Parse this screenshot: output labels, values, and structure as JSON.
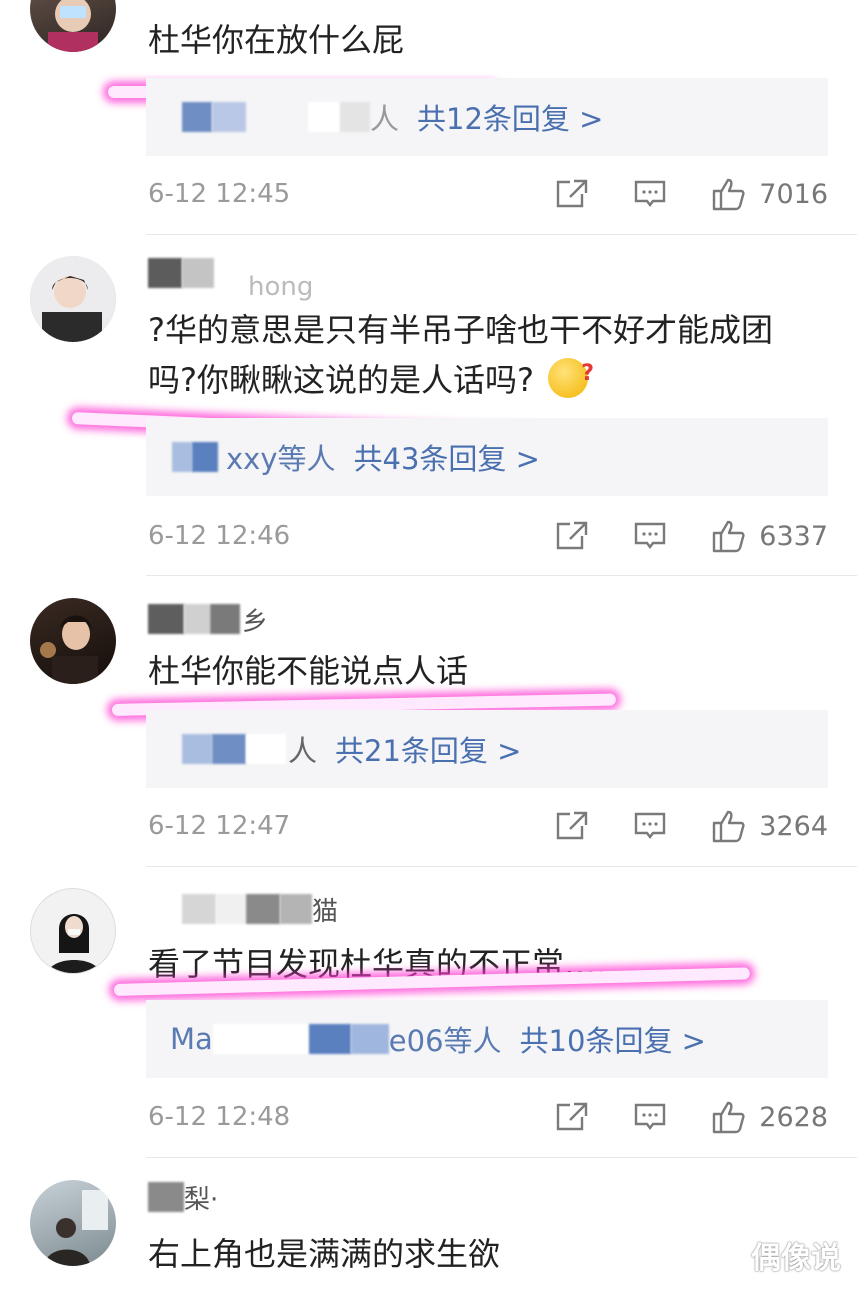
{
  "comments": [
    {
      "username_partial": "",
      "text": "杜华你在放什么屁",
      "reply_names_suffix": "人",
      "reply_count": "共12条回复 >",
      "time": "6-12 12:45",
      "likes": "7016"
    },
    {
      "username_partial": "hong",
      "text_line1": "?华的意思是只有半吊子啥也干不好才能成团",
      "text_line2": "吗?你瞅瞅这说的是人话吗?",
      "reply_names": "xxy等人",
      "reply_count": "共43条回复 >",
      "time": "6-12 12:46",
      "likes": "6337"
    },
    {
      "username_partial": "乡",
      "text": "杜华你能不能说点人话",
      "reply_names_suffix": "人",
      "reply_count": "共21条回复 >",
      "time": "6-12 12:47",
      "likes": "3264"
    },
    {
      "username_partial": "猫",
      "text": "看了节目发现杜华真的不正常……",
      "reply_names_prefix": "Ma",
      "reply_names": "e06等人",
      "reply_count": "共10条回复 >",
      "time": "6-12 12:48",
      "likes": "2628"
    },
    {
      "username_partial": "梨·",
      "text": "右上角也是满满的求生欲"
    }
  ],
  "watermark": "偶像说",
  "icons": {
    "share": "share-icon",
    "comment": "comment-icon",
    "like": "thumbs-up-icon"
  }
}
